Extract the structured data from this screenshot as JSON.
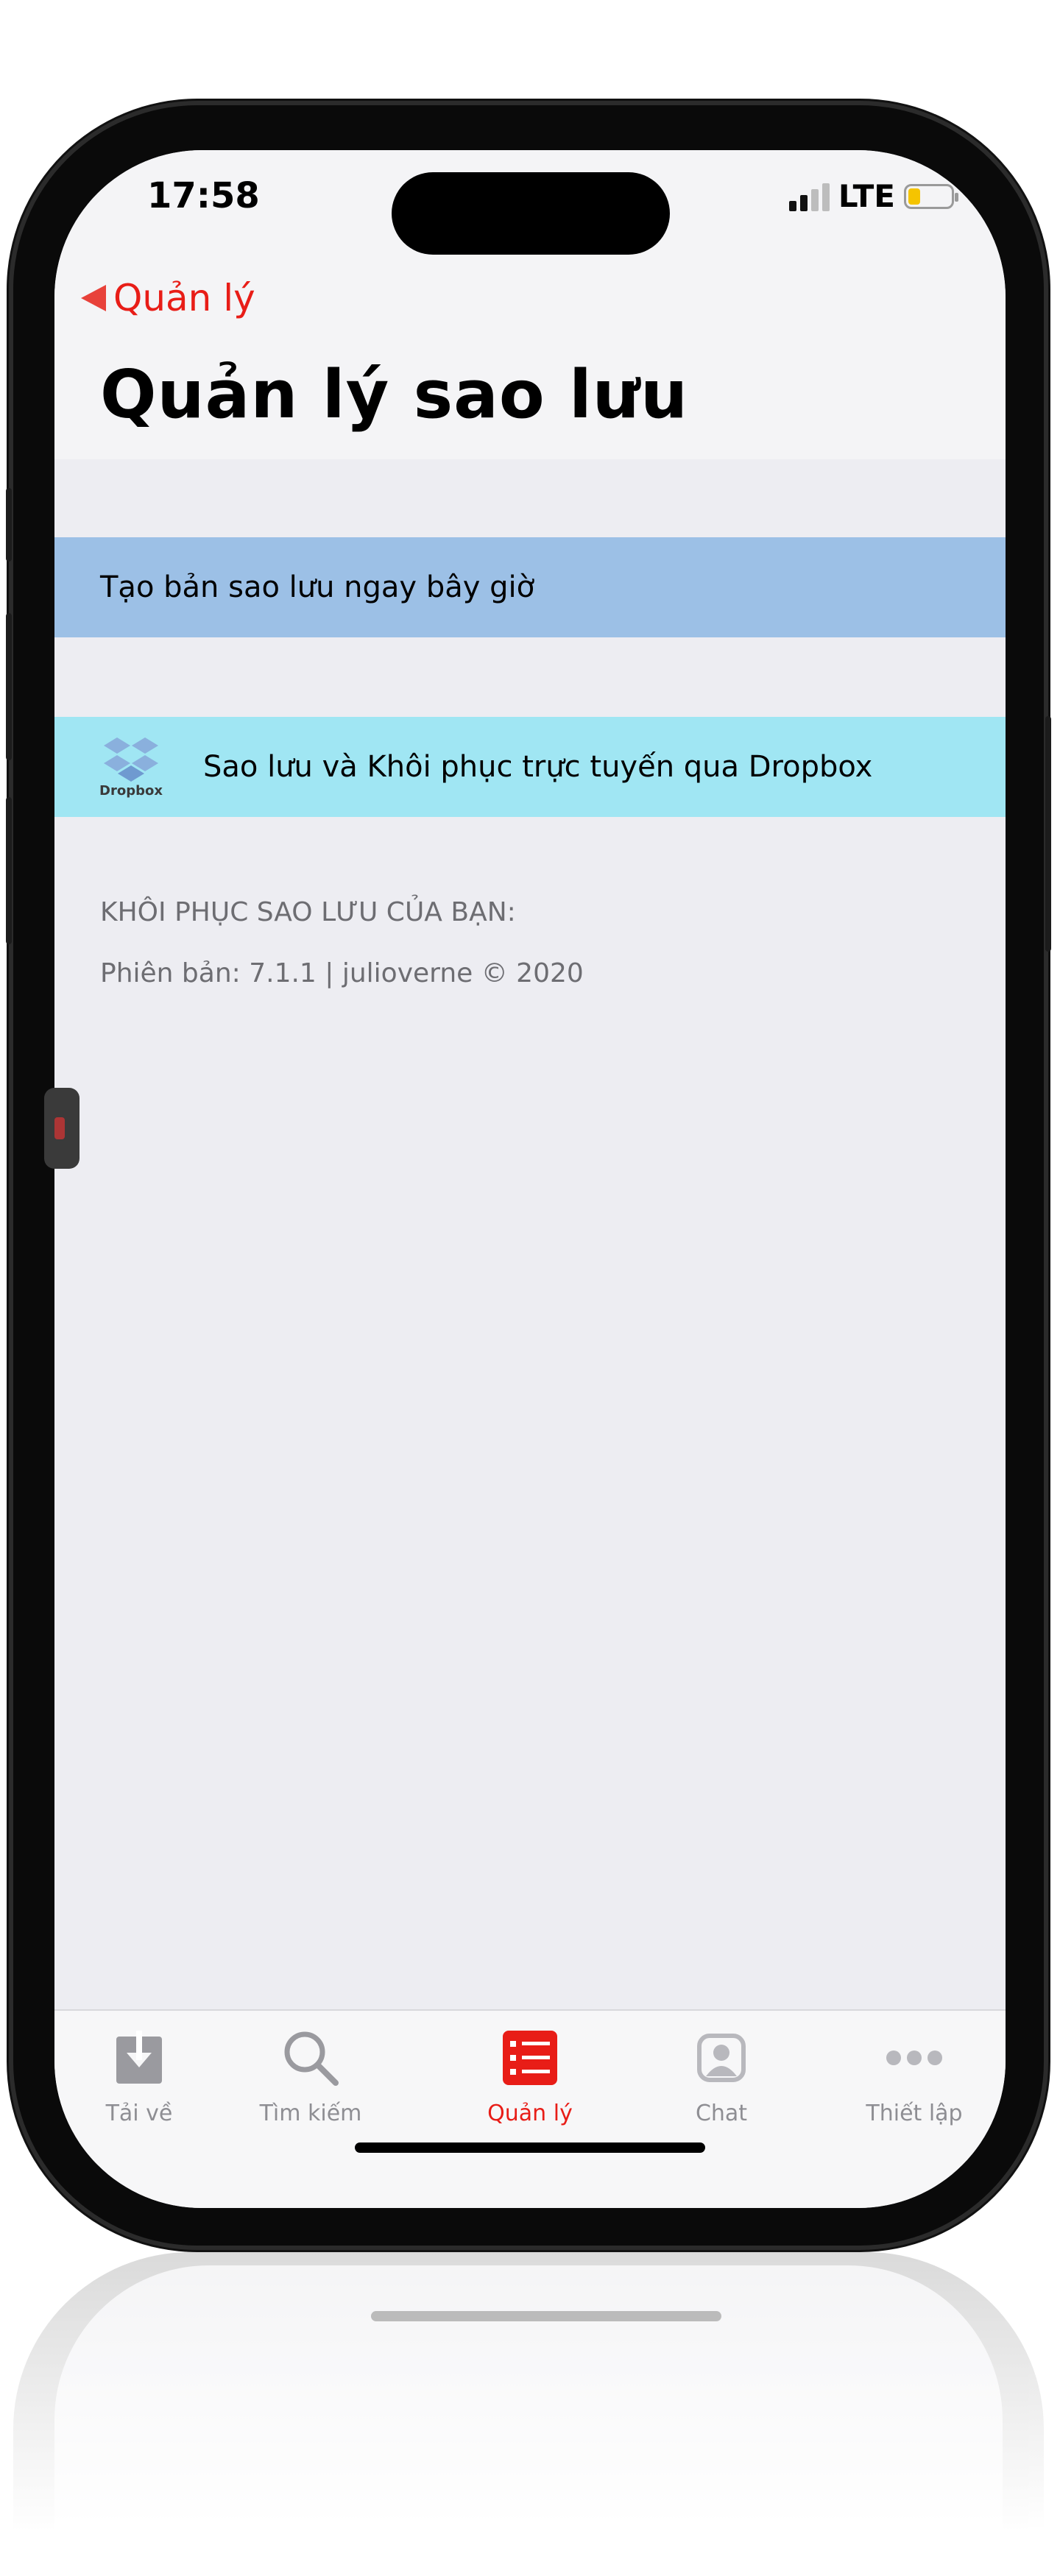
{
  "status_bar": {
    "time": "17:58",
    "network": "LTE"
  },
  "nav": {
    "back_label": "Quản lý",
    "title": "Quản lý sao lưu"
  },
  "rows": {
    "backup_now": "Tạo bản sao lưu ngay bây giờ",
    "dropbox": "Sao lưu và Khôi phục trực tuyến qua Dropbox",
    "dropbox_logo_text": "Dropbox"
  },
  "section": {
    "restore_header": "KHÔI PHỤC SAO LƯU CỦA BẠN:",
    "version_line": "Phiên bản: 7.1.1 | julioverne © 2020"
  },
  "tabbar": {
    "items": [
      {
        "label": "Tải về",
        "icon": "download-icon",
        "active": false
      },
      {
        "label": "Tìm kiếm",
        "icon": "search-icon",
        "active": false
      },
      {
        "label": "Quản lý",
        "icon": "list-icon",
        "active": true
      },
      {
        "label": "Chat",
        "icon": "chat-person-icon",
        "active": false
      },
      {
        "label": "Thiết lập",
        "icon": "more-dots-icon",
        "active": false
      }
    ]
  },
  "colors": {
    "accent": "#e81d17",
    "backup_row": "#9cc0e6",
    "dropbox_row": "#a0e6f3",
    "secondary_text": "#6d6d72"
  }
}
